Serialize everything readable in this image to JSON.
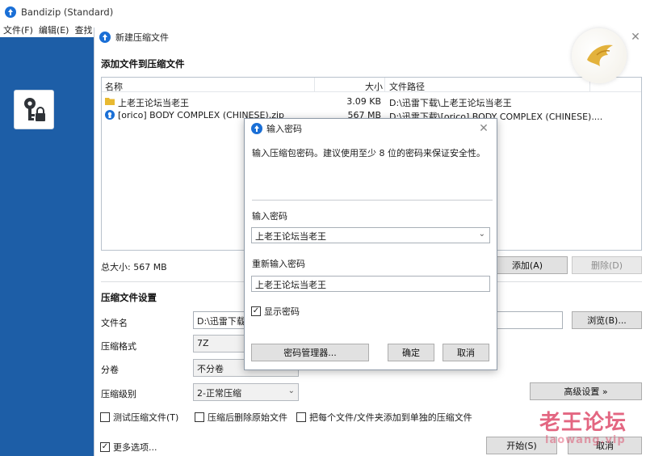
{
  "main_window": {
    "title": "Bandizip (Standard)",
    "menu": [
      "文件(F)",
      "编辑(E)",
      "查找"
    ]
  },
  "archive_window": {
    "title": "新建压缩文件",
    "add_files_section": "添加文件到压缩文件",
    "columns": {
      "name": "名称",
      "size": "大小",
      "path": "文件路径"
    },
    "files": [
      {
        "name": "上老王论坛当老王",
        "size": "3.09 KB",
        "path": "D:\\迅雷下载\\上老王论坛当老王",
        "icon": "folder-icon"
      },
      {
        "name": "[orico] BODY COMPLEX (CHINESE).zip",
        "size": "567 MB",
        "path": "D:\\迅雷下载\\[orico] BODY COMPLEX (CHINESE)....",
        "icon": "archive-icon"
      }
    ],
    "total_size": "总大小: 567 MB",
    "add_button": "添加(A)",
    "delete_button": "删除(D)",
    "settings_section": "压缩文件设置",
    "filename_label": "文件名",
    "filename_value": "D:\\迅雷下载\\",
    "browse_button": "浏览(B)...",
    "format_label": "压缩格式",
    "format_value": "7Z",
    "split_label": "分卷",
    "split_value": "不分卷",
    "level_label": "压缩级别",
    "level_value": "2-正常压缩",
    "advanced_button": "高级设置 »",
    "test_archive": "测试压缩文件(T)",
    "delete_after": "压缩后删除原始文件",
    "separate_archives": "把每个文件/文件夹添加到单独的压缩文件",
    "more_options": "更多选项...",
    "start_button": "开始(S)",
    "cancel_button": "取消"
  },
  "password_dialog": {
    "title": "输入密码",
    "description": "输入压缩包密码。建议使用至少 8 位的密码来保证安全性。",
    "password_label": "输入密码",
    "password_value": "上老王论坛当老王",
    "reenter_label": "重新输入密码",
    "reenter_value": "上老王论坛当老王",
    "show_password": "显示密码",
    "password_manager_button": "密码管理器...",
    "ok_button": "确定",
    "cancel_button": "取消"
  },
  "watermark": {
    "text": "老王论坛",
    "sub": "laowang.vip"
  },
  "colors": {
    "accent": "#1a6fd6",
    "side_panel": "#1d5ea7",
    "watermark": "#db3b5d"
  }
}
